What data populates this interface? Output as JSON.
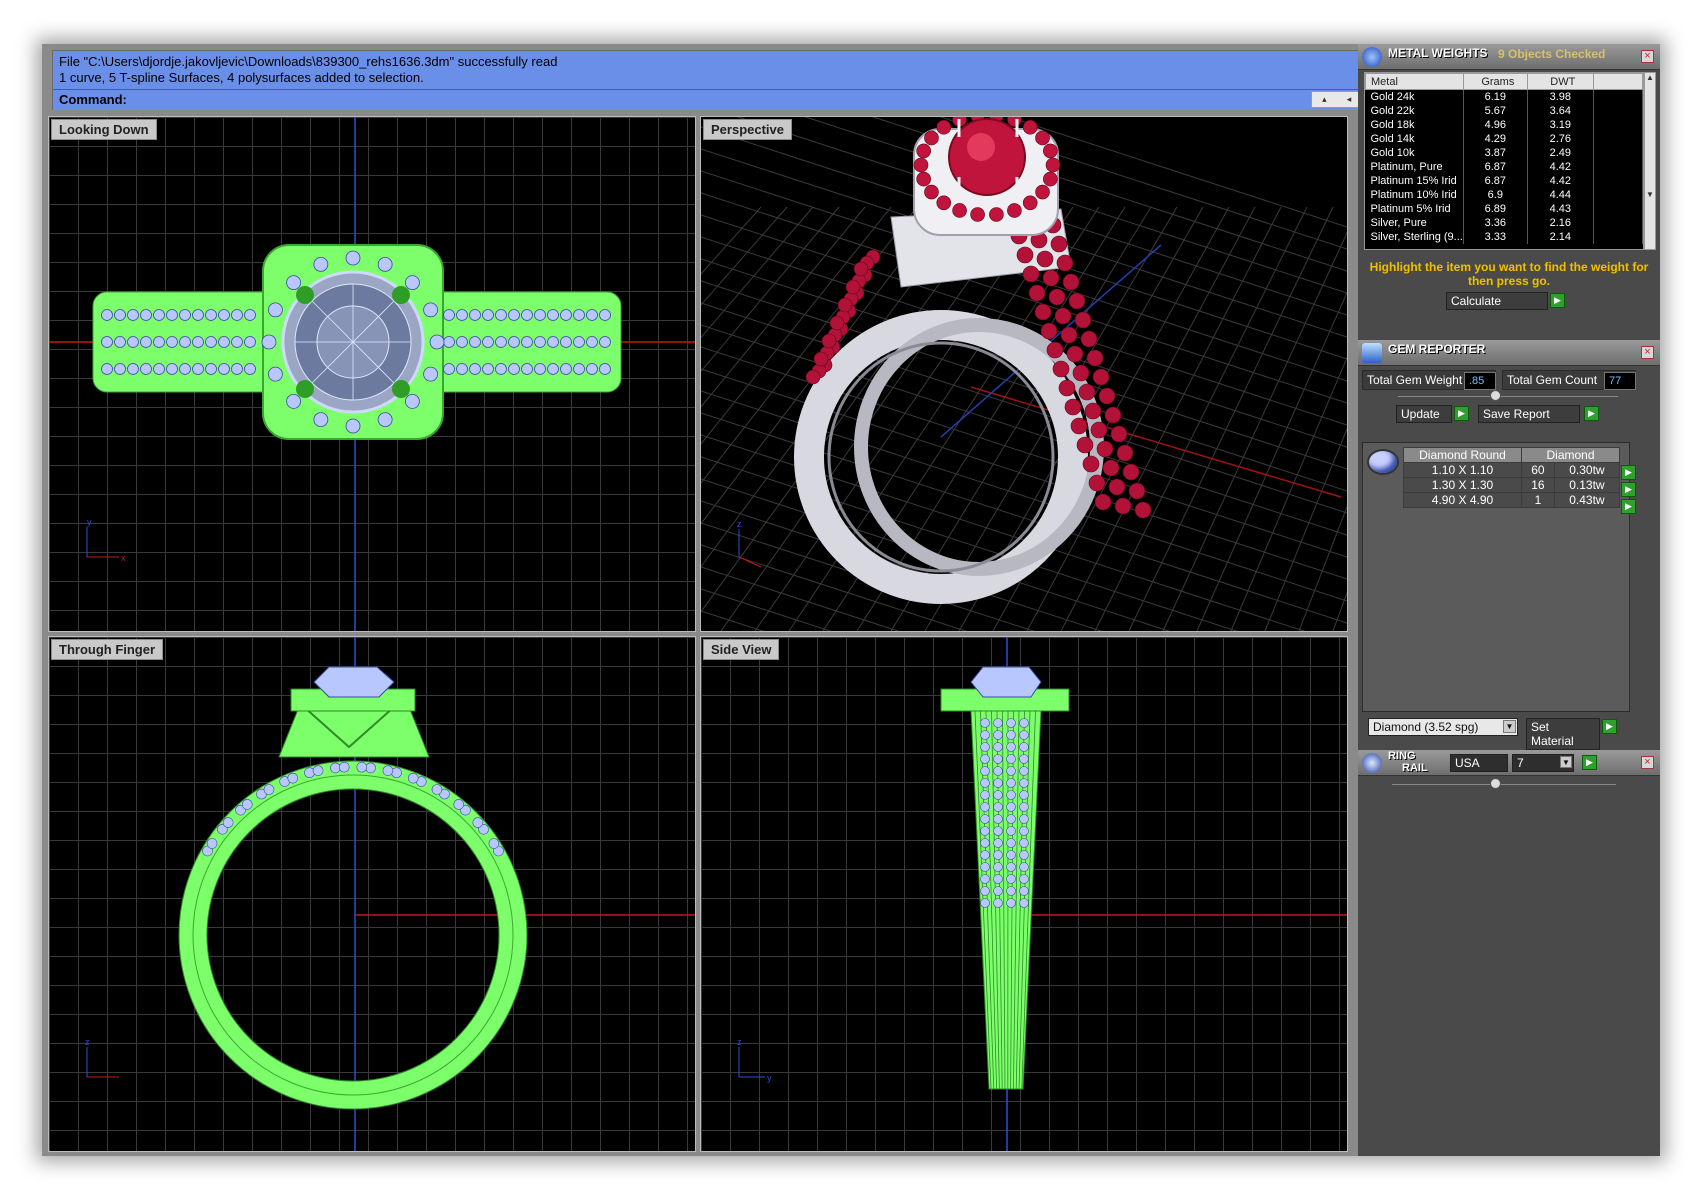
{
  "command_area": {
    "history_line1": "File \"C:\\Users\\djordje.jakovljevic\\Downloads\\839300_rehs1636.3dm\" successfully read",
    "history_line2": "1 curve, 5 T-spline Surfaces, 4 polysurfaces added to selection.",
    "prompt": "Command:"
  },
  "viewports": {
    "top": "Looking Down",
    "perspective": "Perspective",
    "front": "Through Finger",
    "side": "Side View"
  },
  "metal_weights": {
    "title": "METAL WEIGHTS",
    "status": "9 Objects Checked",
    "columns": [
      "Metal",
      "Grams",
      "DWT"
    ],
    "rows": [
      [
        "Gold 24k",
        "6.19",
        "3.98"
      ],
      [
        "Gold 22k",
        "5.67",
        "3.64"
      ],
      [
        "Gold 18k",
        "4.96",
        "3.19"
      ],
      [
        "Gold 14k",
        "4.29",
        "2.76"
      ],
      [
        "Gold 10k",
        "3.87",
        "2.49"
      ],
      [
        "Platinum, Pure",
        "6.87",
        "4.42"
      ],
      [
        "Platinum 15% Irid",
        "6.87",
        "4.42"
      ],
      [
        "Platinum 10% Irid",
        "6.9",
        "4.44"
      ],
      [
        "Platinum 5% Irid",
        "6.89",
        "4.43"
      ],
      [
        "Silver, Pure",
        "3.36",
        "2.16"
      ],
      [
        "Silver, Sterling (9...",
        "3.33",
        "2.14"
      ]
    ],
    "hint": "Highlight the item you want to find the weight for then press go.",
    "calculate": "Calculate"
  },
  "gem_reporter": {
    "title": "GEM REPORTER",
    "total_weight_label": "Total Gem Weight",
    "total_weight": ".85",
    "total_count_label": "Total Gem Count",
    "total_count": "77",
    "update": "Update",
    "save_report": "Save Report",
    "headers": [
      "Diamond Round",
      "Diamond"
    ],
    "rows": [
      [
        "1.10 X 1.10",
        "60",
        "0.30tw"
      ],
      [
        "1.30 X 1.30",
        "16",
        "0.13tw"
      ],
      [
        "4.90 X 4.90",
        "1",
        "0.43tw"
      ]
    ],
    "material": "Diamond    (3.52 spg)",
    "set_material": "Set Material"
  },
  "ring_rail": {
    "title_line1": "RING",
    "title_line2": "RAIL",
    "country": "USA",
    "size": "7"
  },
  "colors": {
    "command_bg": "#6a8fe8",
    "wireframe_green": "#7cff6a",
    "ruby": "#c0143c",
    "hint_yellow": "#f0c000"
  }
}
